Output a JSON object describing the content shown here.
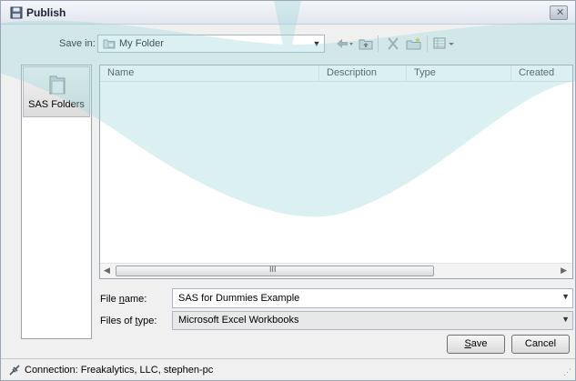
{
  "window": {
    "title": "Publish",
    "close_icon": "close-icon"
  },
  "save_in": {
    "label": "Save in:",
    "value": "My Folder",
    "icon": "folder-icon"
  },
  "toolbar": {
    "icons": [
      "back-arrow-icon",
      "up-folder-icon",
      "delete-icon",
      "new-folder-icon",
      "views-icon"
    ]
  },
  "places": {
    "items": [
      {
        "label": "SAS Folders",
        "icon": "folder-icon"
      }
    ]
  },
  "file_list": {
    "columns": [
      "Name",
      "Description",
      "Type",
      "Created"
    ],
    "rows": [],
    "scroll_grip": "III"
  },
  "file_name": {
    "label": "File name:",
    "value": "SAS for Dummies Example"
  },
  "file_type": {
    "label": "Files of type:",
    "value": "Microsoft Excel Workbooks"
  },
  "buttons": {
    "save": "Save",
    "cancel": "Cancel"
  },
  "status": {
    "text": "Connection: Freakalytics, LLC, stephen-pc",
    "icon": "connection-icon"
  },
  "colors": {
    "swoosh": "#9fd8db",
    "accent": "#1a2330"
  }
}
